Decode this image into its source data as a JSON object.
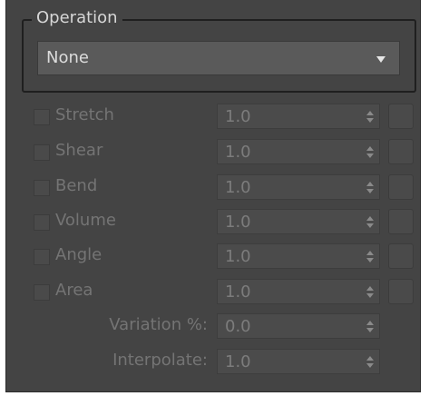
{
  "operation_group": {
    "title": "Operation",
    "selected": "None"
  },
  "rows": [
    {
      "label": "Stretch",
      "value": "1.0"
    },
    {
      "label": "Shear",
      "value": "1.0"
    },
    {
      "label": "Bend",
      "value": "1.0"
    },
    {
      "label": "Volume",
      "value": "1.0"
    },
    {
      "label": "Angle",
      "value": "1.0"
    },
    {
      "label": "Area",
      "value": "1.0"
    }
  ],
  "variation": {
    "label": "Variation %:",
    "value": "0.0"
  },
  "interpolate": {
    "label": "Interpolate:",
    "value": "1.0"
  },
  "colors": {
    "panel_bg": "#444444",
    "disabled_text": "#747474",
    "dropdown_bg": "#5a5a5a"
  }
}
